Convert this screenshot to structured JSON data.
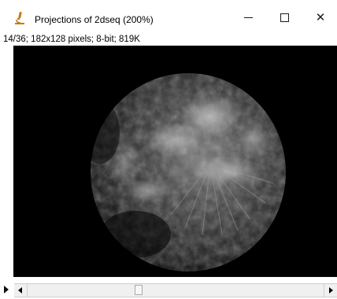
{
  "window": {
    "title": "Projections of 2dseq (200%)",
    "app_icon": "microscope-icon",
    "minimize_icon": "minimize-icon",
    "maximize_icon": "maximize-icon",
    "close_icon": "close-icon",
    "close_glyph": "✕"
  },
  "image_info": {
    "text": "14/36; 182x128 pixels; 8-bit; 819K"
  },
  "slice": {
    "current": 14,
    "total": 36
  },
  "controls": {
    "play_icon": "play-icon",
    "scroll_left_icon": "scroll-left-icon",
    "scroll_right_icon": "scroll-right-icon"
  },
  "colors": {
    "icon_accent": "#c87a14",
    "canvas_background": "#000000"
  }
}
